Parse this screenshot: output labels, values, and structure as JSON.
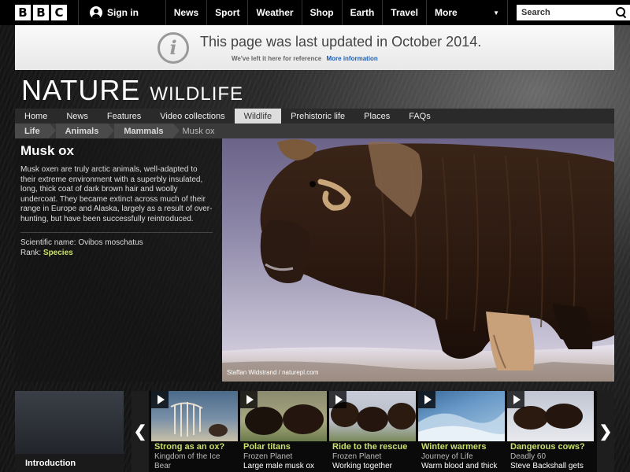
{
  "masthead": {
    "logo_letters": [
      "B",
      "B",
      "C"
    ],
    "signin_label": "Sign in",
    "nav": [
      "News",
      "Sport",
      "Weather",
      "Shop",
      "Earth",
      "Travel"
    ],
    "more_label": "More",
    "search_placeholder": "Search"
  },
  "notice": {
    "title": "This page was last updated in October 2014.",
    "subtext": "We've left it here for reference",
    "link": "More information"
  },
  "site": {
    "title_main": "NATURE",
    "title_sub": "WILDLIFE"
  },
  "section_nav": {
    "items": [
      "Home",
      "News",
      "Features",
      "Video collections",
      "Wildlife",
      "Prehistoric life",
      "Places",
      "FAQs"
    ],
    "active": "Wildlife"
  },
  "breadcrumb": {
    "items": [
      "Life",
      "Animals",
      "Mammals"
    ],
    "current": "Musk ox"
  },
  "species": {
    "name": "Musk ox",
    "description": "Musk oxen are truly arctic animals, well-adapted to their extreme environment with a superbly insulated, long, thick coat of dark brown hair and woolly undercoat. They became extinct across much of their range in Europe and Alaska, largely as a result of over-hunting, but have been successfully reintroduced.",
    "scientific_label": "Scientific name:",
    "scientific_name": "Ovibos moschatus",
    "rank_label": "Rank:",
    "rank": "Species"
  },
  "hero": {
    "credit": "Staffan Widstrand / naturepl.com"
  },
  "carousel": {
    "intro_label": "Introduction",
    "prev_arrow": "❮",
    "next_arrow": "❯",
    "cards": [
      {
        "title": "Strong as an ox?",
        "subtitle": "Kingdom of the Ice Bear",
        "desc": ""
      },
      {
        "title": "Polar titans",
        "subtitle": "Frozen Planet",
        "desc": "Large male musk ox"
      },
      {
        "title": "Ride to the rescue",
        "subtitle": "Frozen Planet",
        "desc": "Working together"
      },
      {
        "title": "Winter warmers",
        "subtitle": "Journey of Life",
        "desc": "Warm blood and thick"
      },
      {
        "title": "Dangerous cows?",
        "subtitle": "Deadly 60",
        "desc": "Steve Backshall gets"
      }
    ]
  },
  "colors": {
    "accent_green": "#c9e06a",
    "link_blue": "#1a5fb4"
  }
}
